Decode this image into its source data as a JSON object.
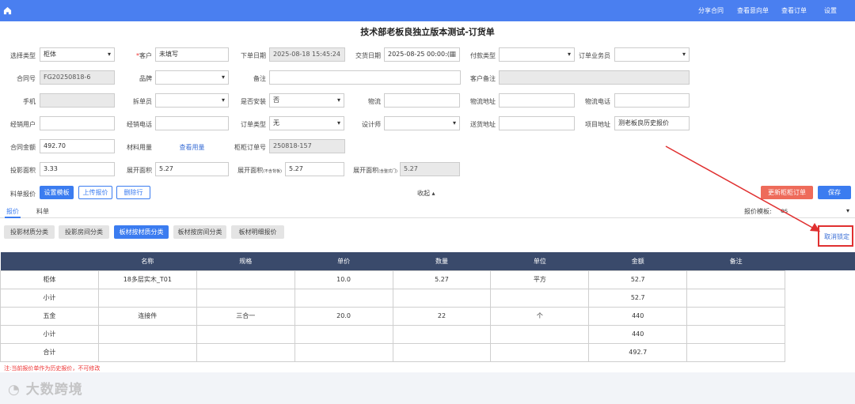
{
  "nav": {
    "share": "分享合同",
    "view_intent": "查看意向单",
    "view_orders": "查看订单",
    "settings": "设置"
  },
  "page_title": "技术部老板良独立版本测试-订货单",
  "form": {
    "select_type": {
      "label": "选择类型",
      "value": "柜体"
    },
    "customer": {
      "label": "客户",
      "required": "*",
      "value": "未填写"
    },
    "order_date": {
      "label": "下单日期",
      "value": "2025-08-18 15:45:24"
    },
    "delivery_date": {
      "label": "交货日期",
      "value": "2025-08-25 00:00:("
    },
    "payment_type": {
      "label": "付款类型",
      "value": ""
    },
    "salesman": {
      "label": "订单业务员",
      "value": ""
    },
    "contract_no": {
      "label": "合同号",
      "value": "FG20250818-6"
    },
    "brand": {
      "label": "品牌",
      "value": ""
    },
    "remark": {
      "label": "备注",
      "value": ""
    },
    "customer_remark": {
      "label": "客户备注",
      "value": ""
    },
    "phone": {
      "label": "手机",
      "value": ""
    },
    "splitter": {
      "label": "拆单员",
      "value": ""
    },
    "install": {
      "label": "是否安装",
      "value": "否"
    },
    "logistics": {
      "label": "物流",
      "value": ""
    },
    "logistics_addr": {
      "label": "物流地址",
      "value": ""
    },
    "logistics_phone": {
      "label": "物流电话",
      "value": ""
    },
    "dealer_user": {
      "label": "经销用户",
      "value": ""
    },
    "dealer_phone": {
      "label": "经销电话",
      "value": ""
    },
    "order_type": {
      "label": "订单类型",
      "value": "无"
    },
    "designer": {
      "label": "设计师",
      "value": ""
    },
    "ship_addr": {
      "label": "送货地址",
      "value": ""
    },
    "project_addr": {
      "label": "项目地址",
      "value": "测老板良历史报价"
    },
    "contract_amount": {
      "label": "合同金额",
      "value": "492.70"
    },
    "material_usage": {
      "label": "材料用量",
      "link": "查看用量"
    },
    "cabinet_order_no": {
      "label": "柜柜订单号",
      "value": "250818-157"
    },
    "projection_area": {
      "label": "投影面积",
      "value": "3.33"
    },
    "unfold_area": {
      "label": "展开面积",
      "value": "5.27"
    },
    "unfold_area_no_back": {
      "label": "展开面积",
      "label_small": "(不含背板)",
      "value": "5.27"
    },
    "unfold_area_with_door": {
      "label": "展开面积",
      "label_small": "(含整式门)",
      "value": "5.27"
    }
  },
  "actions": {
    "bom_quote_label": "料单报价",
    "set_template": "设置模板",
    "upload_quote": "上传报价",
    "delete_row": "删除行",
    "collapse": "收起",
    "update_cabinet_order": "更新柜柜订单",
    "save": "保存"
  },
  "tabs": {
    "quote": "报价",
    "bom": "料单",
    "quote_template_label": "报价模板:",
    "quote_template_value": "es"
  },
  "category_buttons": [
    "投影材质分类",
    "投影房间分类",
    "板材按材质分类",
    "板材按房间分类",
    "板材明细报价"
  ],
  "unlock_link": "取消锁定",
  "table": {
    "headers": [
      "",
      "名称",
      "规格",
      "单价",
      "数量",
      "单位",
      "金额",
      "备注"
    ],
    "rows": [
      [
        "柜体",
        "18多层实木_T01",
        "",
        "10.0",
        "5.27",
        "平方",
        "52.7",
        ""
      ],
      [
        "小计",
        "",
        "",
        "",
        "",
        "",
        "52.7",
        ""
      ],
      [
        "五金",
        "连接件",
        "三合一",
        "20.0",
        "22",
        "个",
        "440",
        ""
      ],
      [
        "小计",
        "",
        "",
        "",
        "",
        "",
        "440",
        ""
      ],
      [
        "合计",
        "",
        "",
        "",
        "",
        "",
        "492.7",
        ""
      ]
    ]
  },
  "note": "注:当前报价单作为历史报价，不可修改",
  "watermark": "大数跨境",
  "colors": {
    "topbar": "#4a7ff0",
    "primary": "#3b7cf0",
    "danger": "#ee6b5a",
    "table_header": "#3a4a6b",
    "annotation": "#e03030"
  }
}
